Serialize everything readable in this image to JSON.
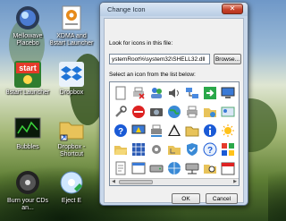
{
  "desktop": {
    "icons": [
      {
        "label": "Mellowave Placebo",
        "icon": "placebo-icon"
      },
      {
        "label": "XDMA and 8start Launcher",
        "icon": "settings-doc-icon"
      },
      {
        "label": "8start Launcher",
        "icon": "start-launcher-icon"
      },
      {
        "label": "Dropbox",
        "icon": "dropbox-icon"
      },
      {
        "label": "Bubbles",
        "icon": "bubbles-icon"
      },
      {
        "label": "Dropbox - Shortcut",
        "icon": "folder-shortcut-icon"
      },
      {
        "label": "Burn your CDs an...",
        "icon": "cd-burner-icon"
      },
      {
        "label": "Eject E",
        "icon": "eject-icon"
      }
    ]
  },
  "dialog": {
    "title": "Change Icon",
    "close_symbol": "✕",
    "look_label": "Look for icons in this file:",
    "path_value": "ystemRoot%\\system32\\SHELL32.dll",
    "browse_label": "Browse...",
    "select_label": "Select an icon from the list below:",
    "ok_label": "OK",
    "cancel_label": "Cancel",
    "icons": [
      "blank-document-icon",
      "printer-x-icon",
      "users-icon",
      "speaker-icon",
      "network-icon",
      "arrow-right-icon",
      "monitor-icon",
      "tools-icon",
      "no-entry-icon",
      "camera-icon",
      "globe-icon",
      "printer-icon",
      "network-folder-icon",
      "user-card-icon",
      "help-icon",
      "monitor-warning-icon",
      "printer-net-icon",
      "warning-icon",
      "folder-icon",
      "info-icon",
      "sun-icon",
      "folder-open-icon",
      "network-grid-icon",
      "gear-key-icon",
      "folder-tree-icon",
      "shield-icon",
      "help-blue-icon",
      "windows-icon",
      "document-icon",
      "program-icon",
      "drive-icon",
      "globe-network-icon",
      "drive-network-icon",
      "folder-search-icon",
      "calendar-icon"
    ]
  }
}
